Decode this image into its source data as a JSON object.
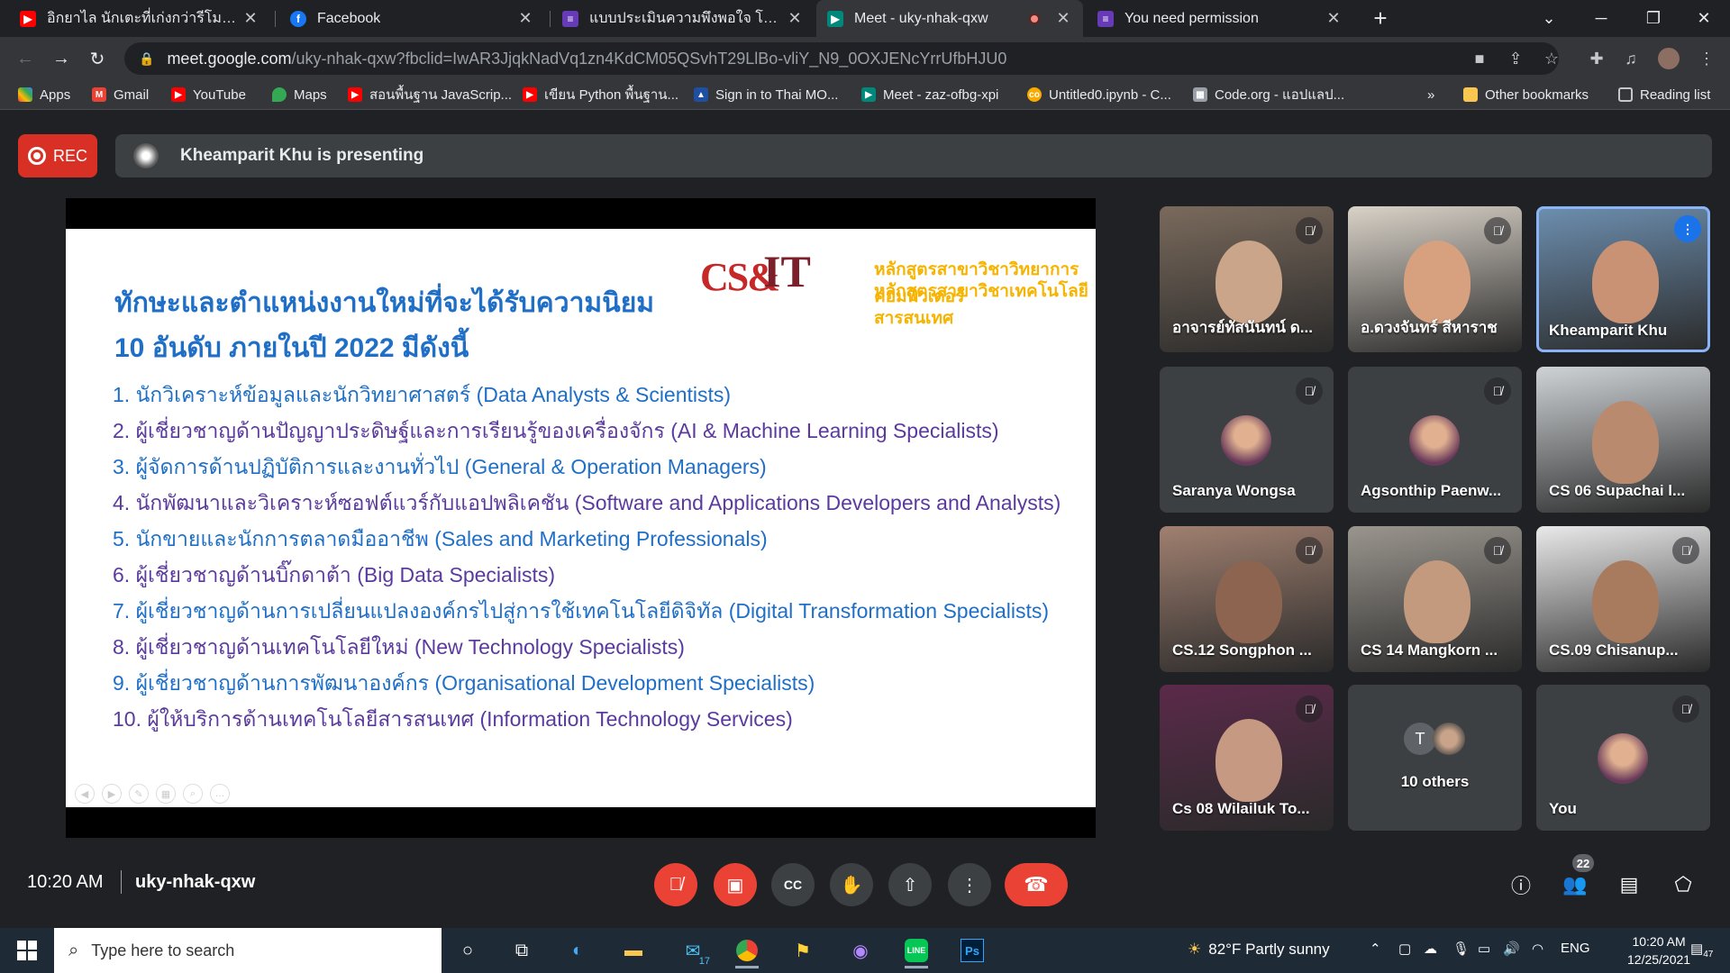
{
  "browser": {
    "tabs": [
      {
        "title": "อิกยาไล นักเตะที่เก่งกว่ารีโมทโทครตระดับ",
        "icon": "youtube-icon",
        "color": "#ff0000"
      },
      {
        "title": "Facebook",
        "icon": "facebook-icon",
        "color": "#1877f2"
      },
      {
        "title": "แบบประเมินความพึงพอใจ โครงการ \"ค",
        "icon": "forms-icon",
        "color": "#673ab7"
      },
      {
        "title": "Meet - uky-nhak-qxw",
        "icon": "meet-icon",
        "color": "#00897b"
      },
      {
        "title": "You need permission",
        "icon": "forms-icon",
        "color": "#673ab7"
      }
    ],
    "address": {
      "host": "meet.google.com",
      "path": "/uky-nhak-qxw?fbclid=IwAR3JjqkNadVq1zn4KdCM05QSvhT29LlBo-vliY_N9_0OXJENcYrrUfbHJU0"
    },
    "bookmarks": [
      {
        "label": "Apps",
        "icon": "apps-grid-icon",
        "color": "#ea4335"
      },
      {
        "label": "Gmail",
        "icon": "gmail-icon",
        "color": "#ea4335"
      },
      {
        "label": "YouTube",
        "icon": "youtube-icon",
        "color": "#ff0000"
      },
      {
        "label": "Maps",
        "icon": "maps-pin-icon",
        "color": "#34a853"
      },
      {
        "label": "สอนพื้นฐาน JavaScrip...",
        "icon": "youtube-icon",
        "color": "#ff0000"
      },
      {
        "label": "เขียน Python พื้นฐาน...",
        "icon": "youtube-icon",
        "color": "#ff0000"
      },
      {
        "label": "Sign in to Thai MO...",
        "icon": "thaimooc-icon",
        "color": "#1e4fa1"
      },
      {
        "label": "Meet - zaz-ofbg-xpi",
        "icon": "meet-icon",
        "color": "#00897b"
      },
      {
        "label": "Untitled0.ipynb - C...",
        "icon": "colab-icon",
        "color": "#f9ab00"
      },
      {
        "label": "Code.org - แอปแลป...",
        "icon": "code-org-icon",
        "color": "#9aa0a6"
      }
    ],
    "other_bookmarks": "Other bookmarks",
    "reading_list": "Reading list",
    "overflow": "»"
  },
  "meet": {
    "rec_label": "REC",
    "presenting_text": "Kheamparit Khu is presenting",
    "meeting_code": "uky-nhak-qxw",
    "time": "10:20 AM",
    "participants_count": "22",
    "slide": {
      "title_line1": "ทักษะและตำแหน่งงานใหม่ที่จะได้รับความนิยม",
      "title_line2": "10 อันดับ ภายในปี 2022 มีดังนี้",
      "logo_cs": "CS&",
      "logo_it": "IT",
      "logo_line1": "หลักสูตรสาขาวิชาวิทยาการคอมพิวเตอร์",
      "logo_line2": "หลักสูตรสาขาวิชาเทคโนโลยีสารสนเทศ",
      "items": [
        {
          "text": "1. นักวิเคราะห์ข้อมูลและนักวิทยาศาสตร์ (Data Analysts & Scientists)",
          "color": "#1f6fc7"
        },
        {
          "text": "2. ผู้เชี่ยวชาญด้านปัญญาประดิษฐ์และการเรียนรู้ของเครื่องจักร (AI & Machine Learning Specialists)",
          "color": "#5b3a9e"
        },
        {
          "text": "3. ผู้จัดการด้านปฏิบัติการและงานทั่วไป (General & Operation Managers)",
          "color": "#1f6fc7"
        },
        {
          "text": "4. นักพัฒนาและวิเคราะห์ซอฟต์แวร์กับแอปพลิเคชัน (Software and Applications Developers and Analysts)",
          "color": "#5b3a9e"
        },
        {
          "text": "5. นักขายและนักการตลาดมืออาชีพ (Sales and Marketing Professionals)",
          "color": "#1f6fc7"
        },
        {
          "text": "6. ผู้เชี่ยวชาญด้านบิ๊กดาต้า (Big Data Specialists)",
          "color": "#5b3a9e"
        },
        {
          "text": "7. ผู้เชี่ยวชาญด้านการเปลี่ยนแปลงองค์กรไปสู่การใช้เทคโนโลยีดิจิทัล (Digital Transformation Specialists)",
          "color": "#1f6fc7"
        },
        {
          "text": "8. ผู้เชี่ยวชาญด้านเทคโนโลยีใหม่ (New Technology Specialists)",
          "color": "#5b3a9e"
        },
        {
          "text": "9. ผู้เชี่ยวชาญด้านการพัฒนาองค์กร (Organisational Development Specialists)",
          "color": "#1f6fc7"
        },
        {
          "text": "10. ผู้ให้บริการด้านเทคโนโลยีสารสนเทศ (Information Technology Services)",
          "color": "#5b3a9e"
        }
      ]
    },
    "tiles": [
      {
        "name": "อาจารย์ทัสนันทน์ ด...",
        "type": "video",
        "muted": true
      },
      {
        "name": "อ.ดวงจันทร์ สีหาราช",
        "type": "video",
        "muted": true
      },
      {
        "name": "Kheamparit Khu",
        "type": "video",
        "muted": false,
        "speaking": true
      },
      {
        "name": "Saranya Wongsa",
        "type": "avatar",
        "muted": true
      },
      {
        "name": "Agsonthip Paenw...",
        "type": "avatar",
        "muted": true
      },
      {
        "name": "CS 06 Supachai l...",
        "type": "video",
        "muted": false
      },
      {
        "name": "CS.12 Songphon ...",
        "type": "video",
        "muted": true
      },
      {
        "name": "CS 14 Mangkorn ...",
        "type": "video",
        "muted": true
      },
      {
        "name": "CS.09 Chisanup...",
        "type": "video",
        "muted": true
      },
      {
        "name": "Cs 08 Wilailuk To...",
        "type": "video",
        "muted": true
      },
      {
        "name": "10 others",
        "type": "others",
        "muted": false,
        "initial": "T"
      },
      {
        "name": "You",
        "type": "avatar",
        "muted": true
      }
    ]
  },
  "taskbar": {
    "search_placeholder": "Type here to search",
    "weather": "82°F  Partly sunny",
    "lang": "ENG",
    "time": "10:20 AM",
    "date": "12/25/2021",
    "mail_badge": "17",
    "notif_badge": "47"
  }
}
